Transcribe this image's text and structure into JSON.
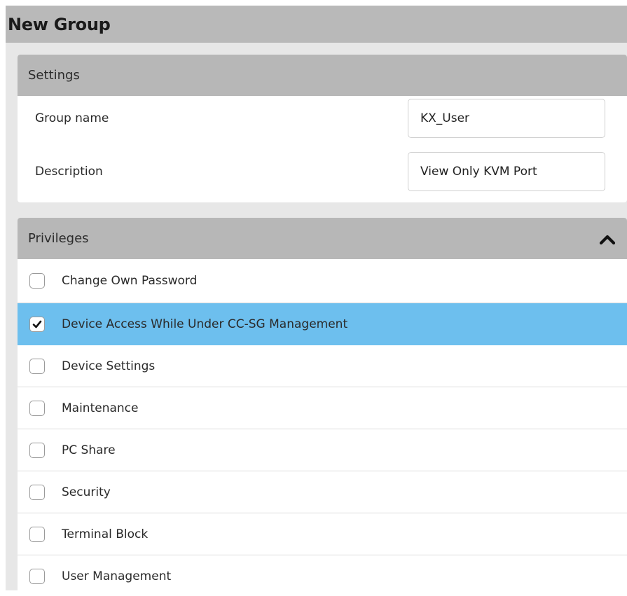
{
  "header": {
    "title": "New Group"
  },
  "settings": {
    "title": "Settings",
    "fields": [
      {
        "label": "Group name",
        "value": "KX_User"
      },
      {
        "label": "Description",
        "value": "View Only KVM Port"
      }
    ]
  },
  "privileges": {
    "title": "Privileges",
    "collapse_icon": "chevron-up-icon",
    "items": [
      {
        "label": "Change Own Password",
        "checked": false
      },
      {
        "label": "Device Access While Under CC-SG Management",
        "checked": true
      },
      {
        "label": "Device Settings",
        "checked": false
      },
      {
        "label": "Maintenance",
        "checked": false
      },
      {
        "label": "PC Share",
        "checked": false
      },
      {
        "label": "Security",
        "checked": false
      },
      {
        "label": "Terminal Block",
        "checked": false
      },
      {
        "label": "User Management",
        "checked": false
      }
    ]
  },
  "colors": {
    "page_background": "#e7e7e7",
    "header_background": "#b9b9b9",
    "panel_header_background": "#b7b7b7",
    "selected_row": "#6dbfee",
    "panel_background": "#ffffff"
  }
}
